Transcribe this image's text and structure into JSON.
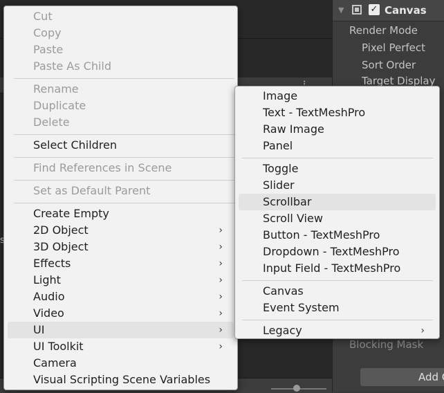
{
  "scene": {
    "left_glyph": "s",
    "toolbar_stub": "⁝"
  },
  "inspector": {
    "component_title": "Canvas",
    "properties": [
      "Render Mode",
      "Pixel Perfect",
      "Sort Order",
      "Target Display"
    ],
    "blocking_mask": "Blocking Mask",
    "add_component_label": "Add C"
  },
  "context_menu": {
    "items": [
      {
        "label": "Cut",
        "enabled": false
      },
      {
        "label": "Copy",
        "enabled": false
      },
      {
        "label": "Paste",
        "enabled": false
      },
      {
        "label": "Paste As Child",
        "enabled": false
      },
      {
        "label": "Rename",
        "enabled": false
      },
      {
        "label": "Duplicate",
        "enabled": false
      },
      {
        "label": "Delete",
        "enabled": false
      },
      {
        "label": "Select Children",
        "enabled": true
      },
      {
        "label": "Find References in Scene",
        "enabled": false
      },
      {
        "label": "Set as Default Parent",
        "enabled": false
      },
      {
        "label": "Create Empty",
        "enabled": true
      },
      {
        "label": "2D Object",
        "enabled": true,
        "submenu": true
      },
      {
        "label": "3D Object",
        "enabled": true,
        "submenu": true
      },
      {
        "label": "Effects",
        "enabled": true,
        "submenu": true
      },
      {
        "label": "Light",
        "enabled": true,
        "submenu": true
      },
      {
        "label": "Audio",
        "enabled": true,
        "submenu": true
      },
      {
        "label": "Video",
        "enabled": true,
        "submenu": true
      },
      {
        "label": "UI",
        "enabled": true,
        "submenu": true,
        "highlighted": true
      },
      {
        "label": "UI Toolkit",
        "enabled": true,
        "submenu": true
      },
      {
        "label": "Camera",
        "enabled": true
      },
      {
        "label": "Visual Scripting Scene Variables",
        "enabled": true
      }
    ]
  },
  "ui_submenu": {
    "items": [
      {
        "label": "Image"
      },
      {
        "label": "Text - TextMeshPro"
      },
      {
        "label": "Raw Image"
      },
      {
        "label": "Panel"
      },
      {
        "label": "Toggle"
      },
      {
        "label": "Slider"
      },
      {
        "label": "Scrollbar",
        "highlighted": true
      },
      {
        "label": "Scroll View"
      },
      {
        "label": "Button - TextMeshPro"
      },
      {
        "label": "Dropdown - TextMeshPro"
      },
      {
        "label": "Input Field - TextMeshPro"
      },
      {
        "label": "Canvas"
      },
      {
        "label": "Event System"
      },
      {
        "label": "Legacy",
        "submenu": true
      }
    ]
  },
  "icons": {
    "submenu_arrow": "chevron-right-icon",
    "foldout": "triangle-down-icon",
    "checkbox": "check-icon",
    "component": "canvas-icon"
  }
}
